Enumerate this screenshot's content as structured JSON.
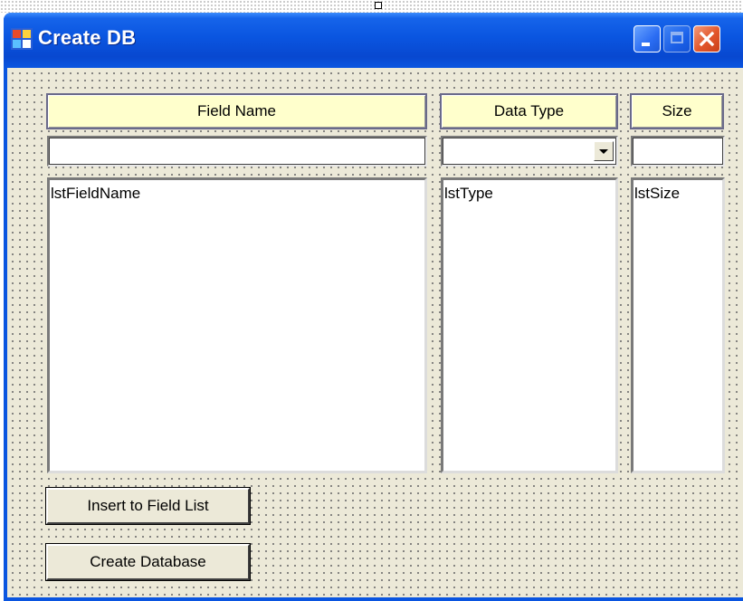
{
  "window": {
    "title": "Create DB",
    "caption_buttons": [
      "minimize",
      "maximize",
      "close"
    ]
  },
  "headers": {
    "field_name": "Field Name",
    "data_type": "Data Type",
    "size": "Size"
  },
  "inputs": {
    "field_name_value": "",
    "data_type_value": "",
    "size_value": ""
  },
  "lists": {
    "field_name": "lstFieldName",
    "type": "lstType",
    "size": "lstSize"
  },
  "buttons": {
    "insert": "Insert to Field List",
    "create": "Create Database"
  },
  "colors": {
    "titlebar": "#0a55e0",
    "header_bg": "#ffffcc",
    "client_bg": "#ece9d8",
    "close_button": "#e2562b"
  }
}
